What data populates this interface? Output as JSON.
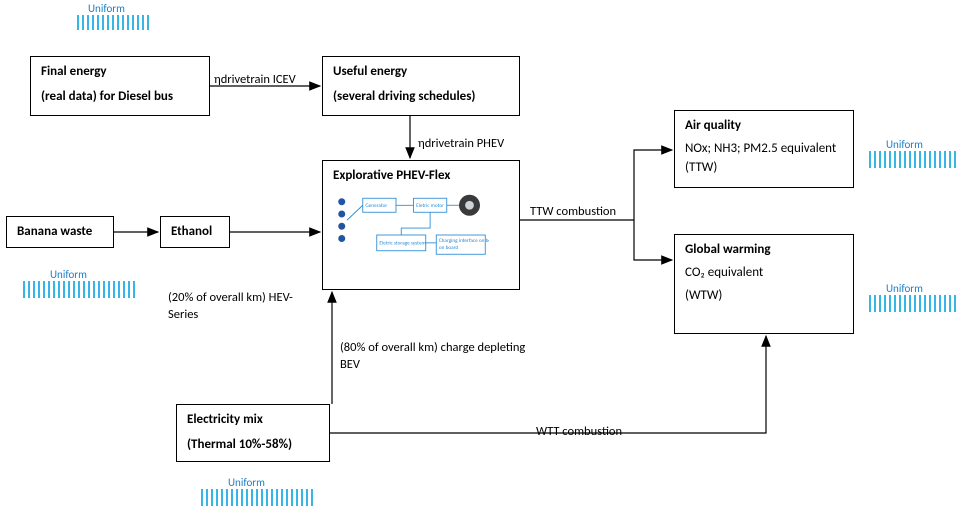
{
  "uniform_label": "Uniform",
  "boxes": {
    "final_energy": {
      "l1": "Final energy",
      "l2": "(real data) for Diesel bus"
    },
    "useful_energy": {
      "l1": "Useful energy",
      "l2": "(several driving schedules)"
    },
    "banana": {
      "l1": "Banana waste"
    },
    "ethanol": {
      "l1": "Ethanol"
    },
    "phev": {
      "l1": "Explorative PHEV-Flex"
    },
    "elec": {
      "l1": "Electricity mix",
      "l2": "(Thermal 10%-58%)"
    },
    "air": {
      "l1": "Air quality",
      "l2": "NOx; NH3; PM2.5 equivalent (TTW)"
    },
    "gw": {
      "l1": "Global warming",
      "l2": "CO₂ equivalent",
      "l3": "(WTW)"
    }
  },
  "labels": {
    "eta_icev": "ηdrivetrain ICEV",
    "eta_phev": "ηdrivetrain PHEV",
    "hev_note": "(20% of overall km) HEV-Series",
    "bev_note": "(80% of overall km) charge depleting BEV",
    "ttw": "TTW combustion",
    "wtt": "WTT combustion"
  },
  "phev_inner": {
    "gen": "Generator",
    "motor": "Eletric motor",
    "storage": "Eletric storage system",
    "charge": "Charging interface on board"
  }
}
